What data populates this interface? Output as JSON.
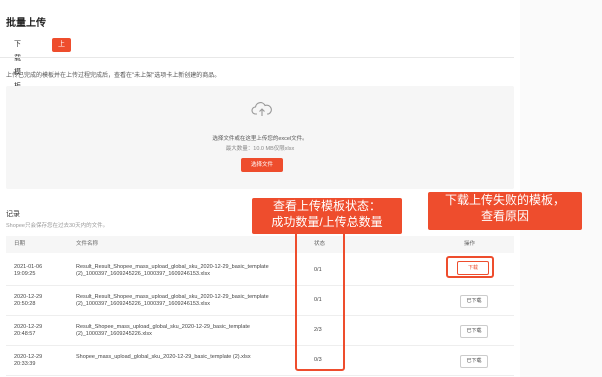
{
  "page": {
    "title": "批量上传",
    "tabs": [
      {
        "label": "下载模板"
      },
      {
        "label": "上传文件"
      }
    ],
    "description": "上传已完成的模板并在上传过程完成后，查看在\"未上架\"选项卡上新创建的商品。"
  },
  "upload": {
    "hint": "选择文件或在这里上传您的excel文件。",
    "limit": "最大数量：10.0 MB仅限xlsx",
    "button_label": "选择文件",
    "icon": "cloud-upload-icon"
  },
  "records": {
    "title": "记录",
    "subtitle": "Shopee只会保存您在过去30天内的文件。",
    "columns": {
      "date": "日期",
      "filename": "文件名称",
      "status": "状态",
      "action": "操作"
    },
    "rows": [
      {
        "date": "2021-01-06 19:09:25",
        "filename": "Result_Result_Shopee_mass_upload_global_sku_2020-12-29_basic_template (2)_1000397_1609245226_1000397_1609246153.xlsx",
        "status": "0/1",
        "action": "下载"
      },
      {
        "date": "2020-12-29 20:50:28",
        "filename": "Result_Result_Shopee_mass_upload_global_sku_2020-12-29_basic_template (2)_1000397_1609245226_1000397_1609246153.xlsx",
        "status": "0/1",
        "action": "已下载"
      },
      {
        "date": "2020-12-29 20:48:57",
        "filename": "Result_Shopee_mass_upload_global_sku_2020-12-29_basic_template (2)_1000397_1609245226.xlsx",
        "status": "2/3",
        "action": "已下载"
      },
      {
        "date": "2020-12-29 20:33:39",
        "filename": "Shopee_mass_upload_global_sku_2020-12-29_basic_template (2).xlsx",
        "status": "0/3",
        "action": "已下载"
      }
    ]
  },
  "annotations": {
    "status_callout": [
      "查看上传模板状态：",
      "成功数量/上传总数量"
    ],
    "action_callout": [
      "下载上传失败的模板，",
      "查看原因"
    ]
  },
  "colors": {
    "accent": "#ee4d2d"
  }
}
